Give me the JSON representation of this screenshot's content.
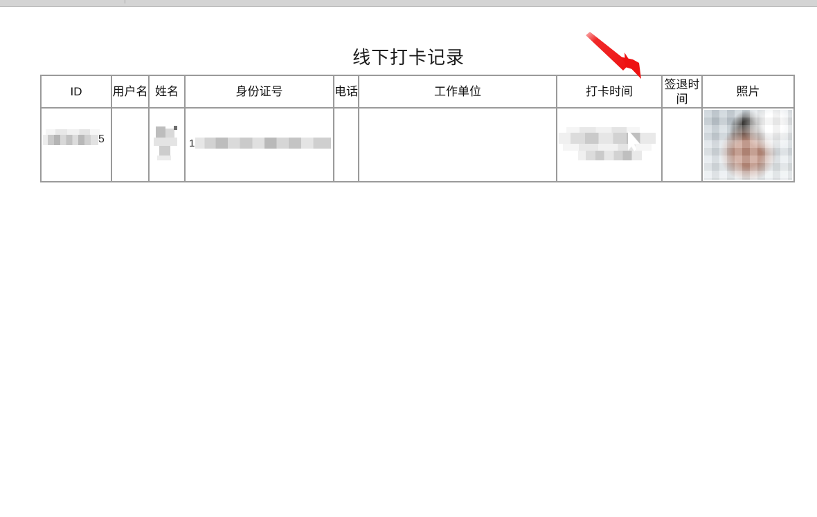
{
  "page": {
    "title": "线下打卡记录"
  },
  "table": {
    "headers": [
      {
        "label": "ID",
        "key": "id"
      },
      {
        "label": "用户名",
        "key": "username"
      },
      {
        "label": "姓名",
        "key": "name"
      },
      {
        "label": "身份证号",
        "key": "id_number"
      },
      {
        "label": "电话",
        "key": "phone"
      },
      {
        "label": "工作单位",
        "key": "work_unit"
      },
      {
        "label": "打卡时间",
        "key": "checkin_time"
      },
      {
        "label": "签退时间",
        "key": "checkout_time"
      },
      {
        "label": "照片",
        "key": "photo"
      }
    ],
    "rows": [
      {
        "id": "5",
        "id_redacted": true,
        "username": "",
        "name": "",
        "name_redacted": true,
        "id_number": "1",
        "id_number_redacted": true,
        "phone": "",
        "work_unit": "",
        "checkin_time": "",
        "checkin_time_redacted": true,
        "checkout_time": "",
        "photo": "face-photo-redacted"
      }
    ]
  },
  "annotations": {
    "arrow": {
      "name": "red-arrow-annotation",
      "color": "#ee1111",
      "points_to": "签退时间"
    },
    "cursor": {
      "name": "mouse-cursor",
      "color": "#ffffff"
    }
  },
  "icons": {
    "arrow": "red-arrow-icon",
    "cursor": "cursor-arrow-icon",
    "photo": "person-photo-icon"
  }
}
